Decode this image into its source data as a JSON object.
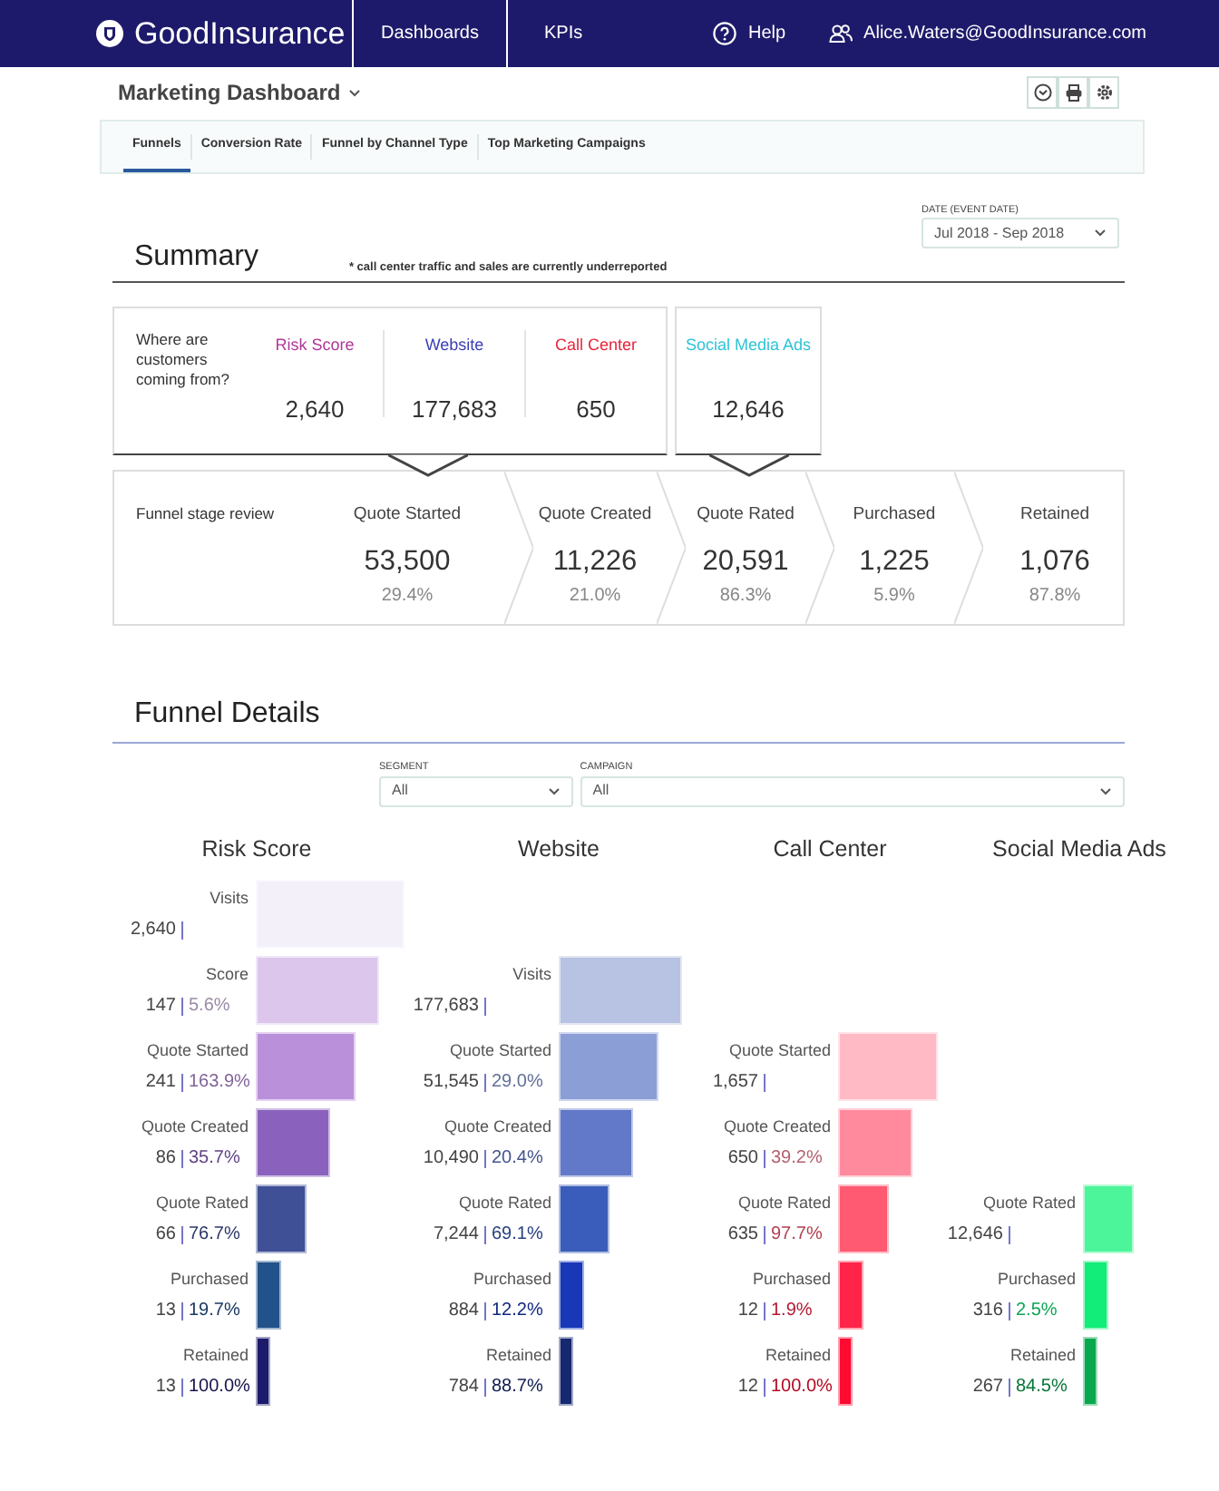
{
  "header": {
    "brand": "GoodInsurance",
    "nav": [
      {
        "label": "Dashboards"
      },
      {
        "label": "KPIs"
      }
    ],
    "help": "Help",
    "user": "Alice.Waters@GoodInsurance.com"
  },
  "dashboard": {
    "title": "Marketing Dashboard"
  },
  "tabs": [
    {
      "label": "Funnels",
      "selected": true
    },
    {
      "label": "Conversion Rate",
      "selected": false
    },
    {
      "label": "Funnel by Channel Type",
      "selected": false
    },
    {
      "label": "Top Marketing Campaigns",
      "selected": false
    }
  ],
  "date_filter": {
    "label": "DATE (EVENT DATE)",
    "value": "Jul 2018 - Sep 2018"
  },
  "summary": {
    "title": "Summary",
    "note": "* call center traffic and sales are currently underreported",
    "sources_label": "Where are customers coming from?",
    "source_groups": [
      [
        {
          "name": "Risk Score",
          "value": "2,640",
          "color": "#b0379a"
        },
        {
          "name": "Website",
          "value": "177,683",
          "color": "#3b3fb5"
        },
        {
          "name": "Call Center",
          "value": "650",
          "color": "#e8243c"
        }
      ],
      [
        {
          "name": "Social Media Ads",
          "value": "12,646",
          "color": "#2fc3d6"
        }
      ]
    ],
    "stage_label": "Funnel stage review",
    "stages": [
      {
        "name": "Quote Started",
        "value": "53,500",
        "percent": "29.4%"
      },
      {
        "name": "Quote Created",
        "value": "11,226",
        "percent": "21.0%"
      },
      {
        "name": "Quote Rated",
        "value": "20,591",
        "percent": "86.3%"
      },
      {
        "name": "Purchased",
        "value": "1,225",
        "percent": "5.9%"
      },
      {
        "name": "Retained",
        "value": "1,076",
        "percent": "87.8%"
      }
    ]
  },
  "funnel_details": {
    "title": "Funnel Details",
    "filters": [
      {
        "label": "SEGMENT",
        "value": "All"
      },
      {
        "label": "CAMPAIGN",
        "value": "All"
      }
    ],
    "channels": [
      {
        "name": "Risk Score",
        "stages": [
          {
            "name": "Visits",
            "value": "2,640",
            "color": "#f3f0fa"
          },
          {
            "name": "Score",
            "value": "147",
            "percent": "5.6%",
            "color": "#dcc6ec"
          },
          {
            "name": "Quote Started",
            "value": "241",
            "percent": "163.9%",
            "color": "#bb90da"
          },
          {
            "name": "Quote Created",
            "value": "86",
            "percent": "35.7%",
            "color": "#8a62bd"
          },
          {
            "name": "Quote Rated",
            "value": "66",
            "percent": "76.7%",
            "color": "#3f5096"
          },
          {
            "name": "Purchased",
            "value": "13",
            "percent": "19.7%",
            "color": "#22528a"
          },
          {
            "name": "Retained",
            "value": "13",
            "percent": "100.0%",
            "color": "#1c1a6b"
          }
        ]
      },
      {
        "name": "Website",
        "stages": [
          {
            "name": "Visits",
            "value": "177,683",
            "color": "#b8c2e2"
          },
          {
            "name": "Quote Started",
            "value": "51,545",
            "percent": "29.0%",
            "color": "#8c9ed6"
          },
          {
            "name": "Quote Created",
            "value": "10,490",
            "percent": "20.4%",
            "color": "#6278c8"
          },
          {
            "name": "Quote Rated",
            "value": "7,244",
            "percent": "69.1%",
            "color": "#3a5cba"
          },
          {
            "name": "Purchased",
            "value": "884",
            "percent": "12.2%",
            "color": "#1838b8"
          },
          {
            "name": "Retained",
            "value": "784",
            "percent": "88.7%",
            "color": "#162870"
          }
        ]
      },
      {
        "name": "Call Center",
        "stages": [
          {
            "name": "Quote Started",
            "value": "1,657",
            "color": "#ffbac6"
          },
          {
            "name": "Quote Created",
            "value": "650",
            "percent": "39.2%",
            "color": "#ff8a9d"
          },
          {
            "name": "Quote Rated",
            "value": "635",
            "percent": "97.7%",
            "color": "#ff5a72"
          },
          {
            "name": "Purchased",
            "value": "12",
            "percent": "1.9%",
            "color": "#ff2448"
          },
          {
            "name": "Retained",
            "value": "12",
            "percent": "100.0%",
            "color": "#ff0a30"
          }
        ]
      },
      {
        "name": "Social Media Ads",
        "stages": [
          {
            "name": "Quote Rated",
            "value": "12,646",
            "color": "#4cf59a"
          },
          {
            "name": "Purchased",
            "value": "316",
            "percent": "2.5%",
            "color": "#12ec78"
          },
          {
            "name": "Retained",
            "value": "267",
            "percent": "84.5%",
            "color": "#0aa84e"
          }
        ]
      }
    ]
  }
}
